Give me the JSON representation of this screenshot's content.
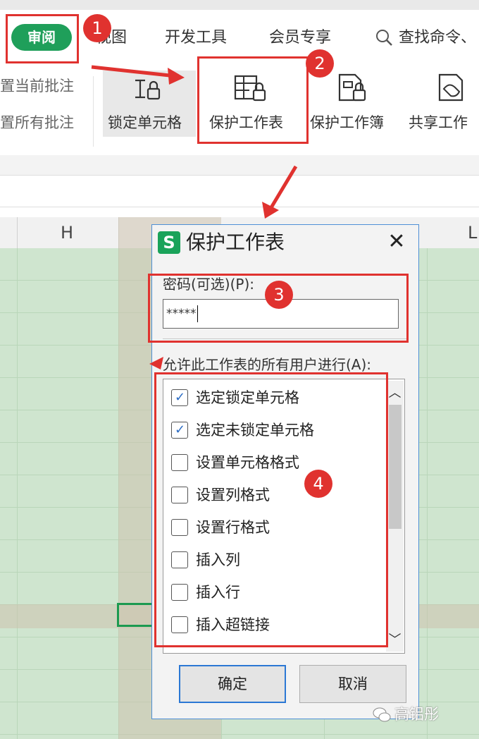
{
  "menu": {
    "review_tab": "审阅",
    "items": [
      "视图",
      "开发工具",
      "会员专享"
    ],
    "search": "查找命令、"
  },
  "ribbon": {
    "left_items": [
      "置当前批注",
      "置所有批注"
    ],
    "buttons": [
      "锁定单元格",
      "保护工作表",
      "保护工作簿",
      "共享工作"
    ]
  },
  "columns": [
    "H",
    "L"
  ],
  "dialog": {
    "logo": "S",
    "title": "保护工作表",
    "close": "✕",
    "password_label": "密码(可选)(P):",
    "password_value": "*****",
    "allow_label": "允许此工作表的所有用户进行(A):",
    "options": [
      {
        "label": "选定锁定单元格",
        "checked": true
      },
      {
        "label": "选定未锁定单元格",
        "checked": true
      },
      {
        "label": "设置单元格格式",
        "checked": false
      },
      {
        "label": "设置列格式",
        "checked": false
      },
      {
        "label": "设置行格式",
        "checked": false
      },
      {
        "label": "插入列",
        "checked": false
      },
      {
        "label": "插入行",
        "checked": false
      },
      {
        "label": "插入超链接",
        "checked": false
      }
    ],
    "ok": "确定",
    "cancel": "取消"
  },
  "annotations": [
    "1",
    "2",
    "3",
    "4"
  ],
  "watermark": "高铝彤",
  "colors": {
    "accent": "#1f9f5a",
    "annotation_red": "#e0322f",
    "dialog_border": "#4e8fd6",
    "checkmark": "#2b6cc4"
  }
}
